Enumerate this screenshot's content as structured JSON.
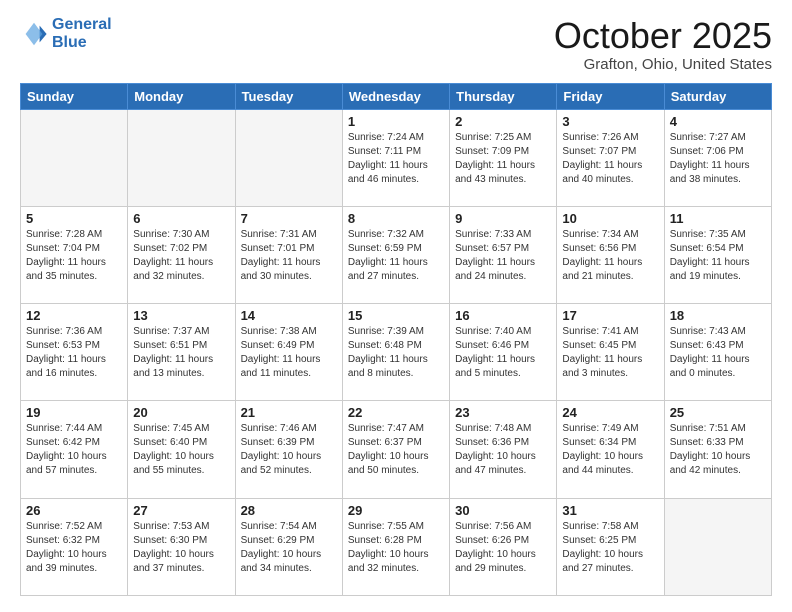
{
  "header": {
    "logo_line1": "General",
    "logo_line2": "Blue",
    "month": "October 2025",
    "location": "Grafton, Ohio, United States"
  },
  "days_of_week": [
    "Sunday",
    "Monday",
    "Tuesday",
    "Wednesday",
    "Thursday",
    "Friday",
    "Saturday"
  ],
  "weeks": [
    [
      {
        "num": "",
        "info": ""
      },
      {
        "num": "",
        "info": ""
      },
      {
        "num": "",
        "info": ""
      },
      {
        "num": "1",
        "info": "Sunrise: 7:24 AM\nSunset: 7:11 PM\nDaylight: 11 hours\nand 46 minutes."
      },
      {
        "num": "2",
        "info": "Sunrise: 7:25 AM\nSunset: 7:09 PM\nDaylight: 11 hours\nand 43 minutes."
      },
      {
        "num": "3",
        "info": "Sunrise: 7:26 AM\nSunset: 7:07 PM\nDaylight: 11 hours\nand 40 minutes."
      },
      {
        "num": "4",
        "info": "Sunrise: 7:27 AM\nSunset: 7:06 PM\nDaylight: 11 hours\nand 38 minutes."
      }
    ],
    [
      {
        "num": "5",
        "info": "Sunrise: 7:28 AM\nSunset: 7:04 PM\nDaylight: 11 hours\nand 35 minutes."
      },
      {
        "num": "6",
        "info": "Sunrise: 7:30 AM\nSunset: 7:02 PM\nDaylight: 11 hours\nand 32 minutes."
      },
      {
        "num": "7",
        "info": "Sunrise: 7:31 AM\nSunset: 7:01 PM\nDaylight: 11 hours\nand 30 minutes."
      },
      {
        "num": "8",
        "info": "Sunrise: 7:32 AM\nSunset: 6:59 PM\nDaylight: 11 hours\nand 27 minutes."
      },
      {
        "num": "9",
        "info": "Sunrise: 7:33 AM\nSunset: 6:57 PM\nDaylight: 11 hours\nand 24 minutes."
      },
      {
        "num": "10",
        "info": "Sunrise: 7:34 AM\nSunset: 6:56 PM\nDaylight: 11 hours\nand 21 minutes."
      },
      {
        "num": "11",
        "info": "Sunrise: 7:35 AM\nSunset: 6:54 PM\nDaylight: 11 hours\nand 19 minutes."
      }
    ],
    [
      {
        "num": "12",
        "info": "Sunrise: 7:36 AM\nSunset: 6:53 PM\nDaylight: 11 hours\nand 16 minutes."
      },
      {
        "num": "13",
        "info": "Sunrise: 7:37 AM\nSunset: 6:51 PM\nDaylight: 11 hours\nand 13 minutes."
      },
      {
        "num": "14",
        "info": "Sunrise: 7:38 AM\nSunset: 6:49 PM\nDaylight: 11 hours\nand 11 minutes."
      },
      {
        "num": "15",
        "info": "Sunrise: 7:39 AM\nSunset: 6:48 PM\nDaylight: 11 hours\nand 8 minutes."
      },
      {
        "num": "16",
        "info": "Sunrise: 7:40 AM\nSunset: 6:46 PM\nDaylight: 11 hours\nand 5 minutes."
      },
      {
        "num": "17",
        "info": "Sunrise: 7:41 AM\nSunset: 6:45 PM\nDaylight: 11 hours\nand 3 minutes."
      },
      {
        "num": "18",
        "info": "Sunrise: 7:43 AM\nSunset: 6:43 PM\nDaylight: 11 hours\nand 0 minutes."
      }
    ],
    [
      {
        "num": "19",
        "info": "Sunrise: 7:44 AM\nSunset: 6:42 PM\nDaylight: 10 hours\nand 57 minutes."
      },
      {
        "num": "20",
        "info": "Sunrise: 7:45 AM\nSunset: 6:40 PM\nDaylight: 10 hours\nand 55 minutes."
      },
      {
        "num": "21",
        "info": "Sunrise: 7:46 AM\nSunset: 6:39 PM\nDaylight: 10 hours\nand 52 minutes."
      },
      {
        "num": "22",
        "info": "Sunrise: 7:47 AM\nSunset: 6:37 PM\nDaylight: 10 hours\nand 50 minutes."
      },
      {
        "num": "23",
        "info": "Sunrise: 7:48 AM\nSunset: 6:36 PM\nDaylight: 10 hours\nand 47 minutes."
      },
      {
        "num": "24",
        "info": "Sunrise: 7:49 AM\nSunset: 6:34 PM\nDaylight: 10 hours\nand 44 minutes."
      },
      {
        "num": "25",
        "info": "Sunrise: 7:51 AM\nSunset: 6:33 PM\nDaylight: 10 hours\nand 42 minutes."
      }
    ],
    [
      {
        "num": "26",
        "info": "Sunrise: 7:52 AM\nSunset: 6:32 PM\nDaylight: 10 hours\nand 39 minutes."
      },
      {
        "num": "27",
        "info": "Sunrise: 7:53 AM\nSunset: 6:30 PM\nDaylight: 10 hours\nand 37 minutes."
      },
      {
        "num": "28",
        "info": "Sunrise: 7:54 AM\nSunset: 6:29 PM\nDaylight: 10 hours\nand 34 minutes."
      },
      {
        "num": "29",
        "info": "Sunrise: 7:55 AM\nSunset: 6:28 PM\nDaylight: 10 hours\nand 32 minutes."
      },
      {
        "num": "30",
        "info": "Sunrise: 7:56 AM\nSunset: 6:26 PM\nDaylight: 10 hours\nand 29 minutes."
      },
      {
        "num": "31",
        "info": "Sunrise: 7:58 AM\nSunset: 6:25 PM\nDaylight: 10 hours\nand 27 minutes."
      },
      {
        "num": "",
        "info": ""
      }
    ]
  ]
}
